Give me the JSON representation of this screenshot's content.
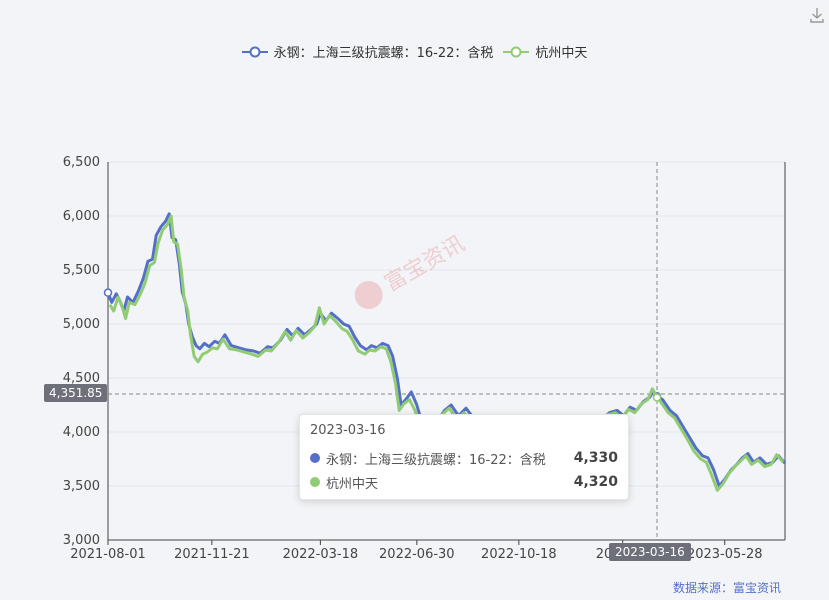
{
  "legend": [
    {
      "name": "永钢：上海三级抗震螺：16-22：含税",
      "color": "#5470c6"
    },
    {
      "name": "杭州中天",
      "color": "#91cc75"
    }
  ],
  "watermark": "富宝资讯",
  "source": {
    "label": "数据来源：",
    "name": "富宝资讯"
  },
  "tooltip": {
    "date": "2023-03-16",
    "rows": [
      {
        "name": "永钢：上海三级抗震螺：16-22：含税",
        "value": "4,330",
        "color": "#5470c6"
      },
      {
        "name": "杭州中天",
        "value": "4,320",
        "color": "#91cc75"
      }
    ]
  },
  "crosshair": {
    "y_label": "4,351.85",
    "x_label": "2023-03-16",
    "y_value": 4351.85,
    "x_date": "2023-03-16"
  },
  "chart_data": {
    "type": "line",
    "x_ticks": [
      "2021-08-01",
      "2021-11-21",
      "2022-03-18",
      "2022-06-30",
      "2022-10-18",
      "2023",
      "2023-05-28"
    ],
    "y_ticks": [
      "3,000",
      "3,500",
      "4,000",
      "4,500",
      "5,000",
      "5,500",
      "6,000",
      "6,500"
    ],
    "ylim": [
      3000,
      6500
    ],
    "xlim": [
      "2021-08-01",
      "2023-08-01"
    ],
    "series": [
      {
        "name": "永钢：上海三级抗震螺：16-22：含税",
        "color": "#5470c6",
        "points": [
          [
            "2021-08-01",
            5290
          ],
          [
            "2021-08-05",
            5200
          ],
          [
            "2021-08-10",
            5280
          ],
          [
            "2021-08-14",
            5210
          ],
          [
            "2021-08-18",
            5120
          ],
          [
            "2021-08-22",
            5250
          ],
          [
            "2021-08-28",
            5200
          ],
          [
            "2021-09-03",
            5310
          ],
          [
            "2021-09-08",
            5420
          ],
          [
            "2021-09-13",
            5580
          ],
          [
            "2021-09-18",
            5600
          ],
          [
            "2021-09-22",
            5820
          ],
          [
            "2021-09-27",
            5900
          ],
          [
            "2021-10-02",
            5950
          ],
          [
            "2021-10-06",
            6020
          ],
          [
            "2021-10-09",
            5800
          ],
          [
            "2021-10-13",
            5780
          ],
          [
            "2021-10-17",
            5550
          ],
          [
            "2021-10-20",
            5300
          ],
          [
            "2021-10-24",
            5180
          ],
          [
            "2021-10-27",
            5000
          ],
          [
            "2021-10-31",
            4880
          ],
          [
            "2021-11-04",
            4800
          ],
          [
            "2021-11-08",
            4770
          ],
          [
            "2021-11-13",
            4820
          ],
          [
            "2021-11-18",
            4790
          ],
          [
            "2021-11-24",
            4840
          ],
          [
            "2021-11-29",
            4820
          ],
          [
            "2021-12-05",
            4900
          ],
          [
            "2021-12-12",
            4800
          ],
          [
            "2021-12-20",
            4780
          ],
          [
            "2021-12-28",
            4760
          ],
          [
            "2022-01-05",
            4750
          ],
          [
            "2022-01-12",
            4730
          ],
          [
            "2022-01-20",
            4790
          ],
          [
            "2022-01-26",
            4780
          ],
          [
            "2022-02-03",
            4850
          ],
          [
            "2022-02-10",
            4950
          ],
          [
            "2022-02-16",
            4890
          ],
          [
            "2022-02-22",
            4960
          ],
          [
            "2022-03-01",
            4900
          ],
          [
            "2022-03-08",
            4950
          ],
          [
            "2022-03-14",
            5000
          ],
          [
            "2022-03-18",
            5100
          ],
          [
            "2022-03-24",
            5030
          ],
          [
            "2022-03-30",
            5100
          ],
          [
            "2022-04-06",
            5050
          ],
          [
            "2022-04-12",
            5000
          ],
          [
            "2022-04-18",
            4980
          ],
          [
            "2022-04-24",
            4880
          ],
          [
            "2022-04-30",
            4800
          ],
          [
            "2022-05-07",
            4760
          ],
          [
            "2022-05-12",
            4800
          ],
          [
            "2022-05-18",
            4780
          ],
          [
            "2022-05-24",
            4820
          ],
          [
            "2022-05-30",
            4800
          ],
          [
            "2022-06-04",
            4700
          ],
          [
            "2022-06-09",
            4500
          ],
          [
            "2022-06-13",
            4250
          ],
          [
            "2022-06-18",
            4300
          ],
          [
            "2022-06-24",
            4370
          ],
          [
            "2022-06-30",
            4250
          ],
          [
            "2022-07-05",
            4100
          ],
          [
            "2022-07-10",
            3850
          ],
          [
            "2022-07-15",
            3900
          ],
          [
            "2022-07-22",
            4100
          ],
          [
            "2022-07-30",
            4200
          ],
          [
            "2022-08-06",
            4250
          ],
          [
            "2022-08-14",
            4150
          ],
          [
            "2022-08-22",
            4220
          ],
          [
            "2022-08-30",
            4130
          ],
          [
            "2022-09-08",
            4080
          ],
          [
            "2022-09-16",
            4100
          ],
          [
            "2022-09-24",
            4050
          ],
          [
            "2022-10-02",
            4090
          ],
          [
            "2022-10-10",
            4000
          ],
          [
            "2022-10-18",
            4020
          ],
          [
            "2022-10-26",
            3900
          ],
          [
            "2022-11-01",
            3780
          ],
          [
            "2022-11-06",
            3700
          ],
          [
            "2022-11-12",
            3720
          ],
          [
            "2022-11-20",
            3850
          ],
          [
            "2022-11-28",
            3900
          ],
          [
            "2022-12-06",
            3950
          ],
          [
            "2022-12-14",
            4000
          ],
          [
            "2022-12-22",
            4020
          ],
          [
            "2022-12-30",
            4040
          ],
          [
            "2023-01-08",
            4080
          ],
          [
            "2023-01-16",
            4120
          ],
          [
            "2023-01-24",
            4180
          ],
          [
            "2023-02-01",
            4200
          ],
          [
            "2023-02-08",
            4150
          ],
          [
            "2023-02-15",
            4230
          ],
          [
            "2023-02-22",
            4200
          ],
          [
            "2023-03-01",
            4280
          ],
          [
            "2023-03-08",
            4320
          ],
          [
            "2023-03-12",
            4380
          ],
          [
            "2023-03-16",
            4330
          ],
          [
            "2023-03-22",
            4300
          ],
          [
            "2023-03-30",
            4200
          ],
          [
            "2023-04-06",
            4150
          ],
          [
            "2023-04-13",
            4050
          ],
          [
            "2023-04-20",
            3950
          ],
          [
            "2023-04-27",
            3850
          ],
          [
            "2023-05-04",
            3780
          ],
          [
            "2023-05-10",
            3760
          ],
          [
            "2023-05-16",
            3650
          ],
          [
            "2023-05-22",
            3500
          ],
          [
            "2023-05-28",
            3560
          ],
          [
            "2023-06-04",
            3650
          ],
          [
            "2023-06-10",
            3700
          ],
          [
            "2023-06-16",
            3760
          ],
          [
            "2023-06-22",
            3800
          ],
          [
            "2023-06-28",
            3720
          ],
          [
            "2023-07-05",
            3760
          ],
          [
            "2023-07-12",
            3700
          ],
          [
            "2023-07-19",
            3720
          ],
          [
            "2023-07-25",
            3780
          ],
          [
            "2023-08-01",
            3710
          ]
        ]
      },
      {
        "name": "杭州中天",
        "color": "#91cc75",
        "points": [
          [
            "2021-08-03",
            5180
          ],
          [
            "2021-08-07",
            5120
          ],
          [
            "2021-08-12",
            5250
          ],
          [
            "2021-08-16",
            5170
          ],
          [
            "2021-08-20",
            5050
          ],
          [
            "2021-08-24",
            5200
          ],
          [
            "2021-08-30",
            5180
          ],
          [
            "2021-09-05",
            5280
          ],
          [
            "2021-09-10",
            5380
          ],
          [
            "2021-09-15",
            5540
          ],
          [
            "2021-09-20",
            5570
          ],
          [
            "2021-09-24",
            5750
          ],
          [
            "2021-09-29",
            5870
          ],
          [
            "2021-10-04",
            5920
          ],
          [
            "2021-10-08",
            6000
          ],
          [
            "2021-10-11",
            5760
          ],
          [
            "2021-10-15",
            5740
          ],
          [
            "2021-10-19",
            5500
          ],
          [
            "2021-10-22",
            5250
          ],
          [
            "2021-10-26",
            5120
          ],
          [
            "2021-10-29",
            4900
          ],
          [
            "2021-11-02",
            4700
          ],
          [
            "2021-11-06",
            4650
          ],
          [
            "2021-11-11",
            4720
          ],
          [
            "2021-11-16",
            4740
          ],
          [
            "2021-11-22",
            4780
          ],
          [
            "2021-11-27",
            4770
          ],
          [
            "2021-12-03",
            4860
          ],
          [
            "2021-12-10",
            4770
          ],
          [
            "2021-12-18",
            4760
          ],
          [
            "2021-12-26",
            4740
          ],
          [
            "2022-01-03",
            4720
          ],
          [
            "2022-01-10",
            4700
          ],
          [
            "2022-01-18",
            4760
          ],
          [
            "2022-01-24",
            4750
          ],
          [
            "2022-02-01",
            4830
          ],
          [
            "2022-02-08",
            4930
          ],
          [
            "2022-02-14",
            4850
          ],
          [
            "2022-02-20",
            4940
          ],
          [
            "2022-02-27",
            4870
          ],
          [
            "2022-03-06",
            4920
          ],
          [
            "2022-03-12",
            4980
          ],
          [
            "2022-03-17",
            5150
          ],
          [
            "2022-03-22",
            5000
          ],
          [
            "2022-03-28",
            5080
          ],
          [
            "2022-04-04",
            5020
          ],
          [
            "2022-04-10",
            4960
          ],
          [
            "2022-04-16",
            4930
          ],
          [
            "2022-04-22",
            4850
          ],
          [
            "2022-04-28",
            4750
          ],
          [
            "2022-05-05",
            4720
          ],
          [
            "2022-05-10",
            4760
          ],
          [
            "2022-05-16",
            4750
          ],
          [
            "2022-05-22",
            4790
          ],
          [
            "2022-05-28",
            4770
          ],
          [
            "2022-06-02",
            4650
          ],
          [
            "2022-06-07",
            4450
          ],
          [
            "2022-06-11",
            4200
          ],
          [
            "2022-06-16",
            4260
          ],
          [
            "2022-06-22",
            4300
          ],
          [
            "2022-06-28",
            4200
          ],
          [
            "2022-07-03",
            4050
          ],
          [
            "2022-07-08",
            3820
          ],
          [
            "2022-07-13",
            3850
          ],
          [
            "2022-07-20",
            4050
          ],
          [
            "2022-07-28",
            4170
          ],
          [
            "2022-08-04",
            4220
          ],
          [
            "2022-08-12",
            4120
          ],
          [
            "2022-08-20",
            4180
          ],
          [
            "2022-08-28",
            4100
          ],
          [
            "2022-09-06",
            4050
          ],
          [
            "2022-09-14",
            4070
          ],
          [
            "2022-09-22",
            4020
          ],
          [
            "2022-09-30",
            4060
          ],
          [
            "2022-10-08",
            3970
          ],
          [
            "2022-10-16",
            3990
          ],
          [
            "2022-10-24",
            3870
          ],
          [
            "2022-10-30",
            3740
          ],
          [
            "2022-11-04",
            3650
          ],
          [
            "2022-11-10",
            3690
          ],
          [
            "2022-11-18",
            3820
          ],
          [
            "2022-11-26",
            3870
          ],
          [
            "2022-12-04",
            3920
          ],
          [
            "2022-12-12",
            3970
          ],
          [
            "2022-12-20",
            4000
          ],
          [
            "2022-12-28",
            4020
          ],
          [
            "2023-01-06",
            4060
          ],
          [
            "2023-01-14",
            4100
          ],
          [
            "2023-01-22",
            4160
          ],
          [
            "2023-01-30",
            4180
          ],
          [
            "2023-02-06",
            4130
          ],
          [
            "2023-02-13",
            4210
          ],
          [
            "2023-02-20",
            4180
          ],
          [
            "2023-02-27",
            4260
          ],
          [
            "2023-03-06",
            4300
          ],
          [
            "2023-03-11",
            4400
          ],
          [
            "2023-03-16",
            4320
          ],
          [
            "2023-03-20",
            4280
          ],
          [
            "2023-03-28",
            4180
          ],
          [
            "2023-04-04",
            4130
          ],
          [
            "2023-04-11",
            4030
          ],
          [
            "2023-04-18",
            3930
          ],
          [
            "2023-04-25",
            3820
          ],
          [
            "2023-05-02",
            3750
          ],
          [
            "2023-05-08",
            3720
          ],
          [
            "2023-05-14",
            3600
          ],
          [
            "2023-05-20",
            3460
          ],
          [
            "2023-05-26",
            3520
          ],
          [
            "2023-06-02",
            3620
          ],
          [
            "2023-06-08",
            3680
          ],
          [
            "2023-06-14",
            3730
          ],
          [
            "2023-06-20",
            3780
          ],
          [
            "2023-06-26",
            3700
          ],
          [
            "2023-07-03",
            3740
          ],
          [
            "2023-07-10",
            3680
          ],
          [
            "2023-07-17",
            3700
          ],
          [
            "2023-07-23",
            3790
          ],
          [
            "2023-07-30",
            3720
          ]
        ]
      }
    ]
  }
}
